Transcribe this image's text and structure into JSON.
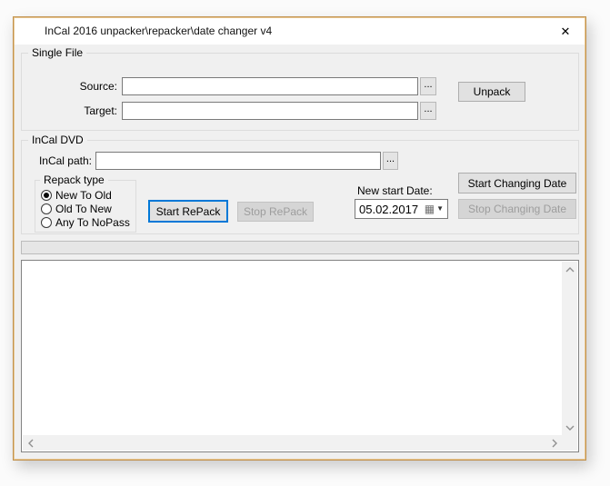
{
  "window": {
    "title": "InCal 2016 unpacker\\repacker\\date changer v4"
  },
  "single_file": {
    "group_label": "Single File",
    "source": {
      "label": "Source:",
      "value": "",
      "browse_label": "..."
    },
    "target": {
      "label": "Target:",
      "value": "",
      "browse_label": "..."
    },
    "unpack_button": "Unpack"
  },
  "incal_dvd": {
    "group_label": "InCal DVD",
    "path": {
      "label": "InCal path:",
      "value": "",
      "browse_label": "..."
    },
    "repack_type": {
      "group_label": "Repack type",
      "options": [
        {
          "label": "New To Old",
          "selected": true
        },
        {
          "label": "Old To New",
          "selected": false
        },
        {
          "label": "Any To NoPass",
          "selected": false
        }
      ]
    },
    "buttons": {
      "start_repack": "Start RePack",
      "stop_repack": "Stop RePack",
      "start_changing_date": "Start Changing Date",
      "stop_changing_date": "Stop Changing Date"
    },
    "new_start_date": {
      "label": "New start Date:",
      "value": "05.02.2017"
    }
  },
  "progress_bar": {
    "percent": 0
  },
  "log_area": {
    "content": ""
  },
  "icons": {
    "close": "✕",
    "calendar": "▦",
    "dropdown_arrow": "▼"
  },
  "colors": {
    "window_border": "#c2924e",
    "titlebar_bg": "#ffffff",
    "client_bg": "#f0f0f0",
    "focus_accent": "#0078d7",
    "button_face": "#e1e1e1",
    "disabled_button_face": "#d5d5d5",
    "disabled_text": "#9d9d9d"
  }
}
